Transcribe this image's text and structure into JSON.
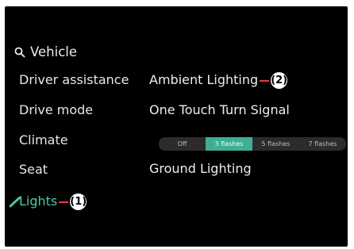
{
  "menu": {
    "header": {
      "icon": "search-icon",
      "title": "Vehicle"
    },
    "items": [
      {
        "label": "Driver assistance"
      },
      {
        "label": "Drive mode"
      },
      {
        "label": "Climate"
      },
      {
        "label": "Seat"
      },
      {
        "label": "Lights",
        "selected": true,
        "icon": "check-icon",
        "callout": "(1)"
      }
    ]
  },
  "settings": {
    "ambient": {
      "label": "Ambient Lighting",
      "callout": "(2)"
    },
    "turn_signal": {
      "label": "One Touch Turn Signal",
      "options": [
        "Off",
        "3 flashes",
        "5 flashes",
        "7 flashes"
      ],
      "selected": "3 flashes"
    },
    "ground": {
      "label": "Ground Lighting"
    }
  },
  "colors": {
    "background": "#000000",
    "accent": "#3fae95",
    "callout_line": "#e04040"
  }
}
